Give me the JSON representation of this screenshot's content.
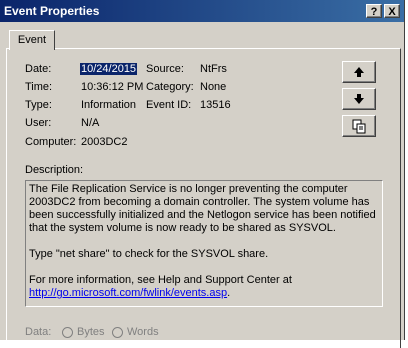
{
  "window": {
    "title": "Event Properties",
    "help_label": "?",
    "close_label": "X"
  },
  "tab": {
    "label": "Event"
  },
  "fields": {
    "date_label": "Date:",
    "date_value": "10/24/2015",
    "source_label": "Source:",
    "source_value": "NtFrs",
    "time_label": "Time:",
    "time_value": "10:36:12 PM",
    "category_label": "Category:",
    "category_value": "None",
    "type_label": "Type:",
    "type_value": "Information",
    "event_id_label": "Event ID:",
    "event_id_value": "13516",
    "user_label": "User:",
    "user_value": "N/A",
    "computer_label": "Computer:",
    "computer_value": "2003DC2"
  },
  "description": {
    "label": "Description:",
    "para1": "The File Replication Service is no longer preventing the computer 2003DC2 from becoming a domain controller. The system volume has been successfully initialized and the Netlogon service has been notified that the system volume is now ready to be shared as SYSVOL.",
    "para2": "Type \"net share\" to check for the SYSVOL share.",
    "para3": "For more information, see Help and Support Center at",
    "link": "http://go.microsoft.com/fwlink/events.asp",
    "link_suffix": "."
  },
  "data_section": {
    "label": "Data:",
    "bytes_label": "Bytes",
    "words_label": "Words"
  }
}
